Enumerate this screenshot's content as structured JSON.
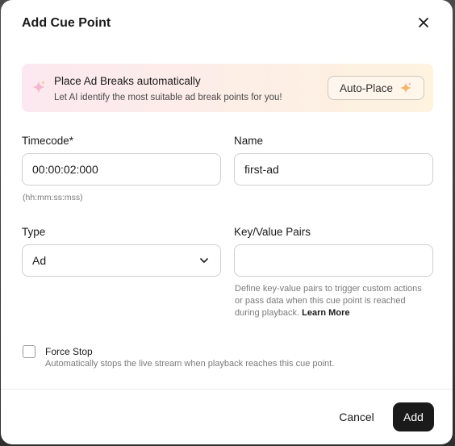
{
  "dialog": {
    "title": "Add Cue Point"
  },
  "banner": {
    "title": "Place Ad Breaks automatically",
    "subtitle": "Let AI identify the most suitable ad break points for you!",
    "button_label": "Auto-Place"
  },
  "fields": {
    "timecode": {
      "label": "Timecode*",
      "value": "00:00:02:000",
      "hint": "(hh:mm:ss:mss)"
    },
    "name": {
      "label": "Name",
      "value": "first-ad"
    },
    "type": {
      "label": "Type",
      "selected": "Ad"
    },
    "kv_pairs": {
      "label": "Key/Value Pairs",
      "value": "",
      "hint": "Define key-value pairs to trigger custom actions or pass data when this cue point is reached during playback.",
      "learn_more": "Learn More"
    }
  },
  "force_stop": {
    "checked": false,
    "label": "Force Stop",
    "description": "Automatically stops the live stream when playback reaches this cue point."
  },
  "footer": {
    "cancel_label": "Cancel",
    "add_label": "Add"
  },
  "colors": {
    "primary_button": "#1a1a1a",
    "sparkle_pink": "#f0a8c4",
    "sparkle_orange": "#f5b46a"
  },
  "icons": {
    "close": "close-icon",
    "sparkle": "sparkle-icon",
    "chevron": "chevron-down-icon"
  }
}
